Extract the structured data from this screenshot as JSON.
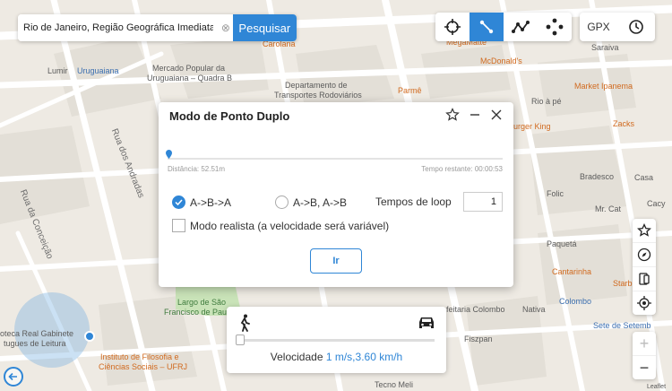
{
  "search": {
    "value": "Rio de Janeiro, Região Geográfica Imediata do",
    "button_label": "Pesquisar"
  },
  "toolbar": {
    "gpx_label": "GPX",
    "accent": "#2f86d6"
  },
  "dialog": {
    "title": "Modo de Ponto Duplo",
    "distance_text": "Distância: 52.51m",
    "remaining_text": "Tempo restante: 00:00:53",
    "option_aba": "A->B->A",
    "option_abab": "A->B, A->B",
    "loop_label": "Tempos de loop",
    "loop_value": "1",
    "realistic_label": "Modo realista (a velocidade será variável)",
    "go_label": "Ir"
  },
  "speed": {
    "label": "Velocidade",
    "value": "1 m/s,3.60 km/h"
  },
  "map_labels": {
    "carolana": "Carolana",
    "megamatte": "MegaMatte",
    "mcdonalds": "McDonald's",
    "saraiva": "Saraiva",
    "lumir": "Lumir",
    "uruguaiana": "Uruguaiana",
    "mercado": "Mercado Popular da",
    "mercado2": "Uruguaiana – Quadra B",
    "departamento": "Departamento de",
    "departamento2": "Transportes Rodoviários",
    "parme": "Parmê",
    "market_ipanema": "Market Ipanema",
    "rio_a_pe": "Rio à pé",
    "zacks": "Zacks",
    "burger_king": "urger King",
    "folic": "Folic",
    "bradesco": "Bradesco",
    "mr_cat": "Mr. Cat",
    "paqueta": "Paquetá",
    "cantarinha": "Cantarinha",
    "colombo": "Colombo",
    "sete_de_setembro": "Sete de Setemb",
    "starb": "Starb",
    "nativa": "Nativa",
    "fiszpan": "Fiszpan",
    "confeitaria_colombo": "feitaria Colombo",
    "largo_sao": "Largo de São",
    "largo_sao2": "Francisco de Paula",
    "instituto": "Instituto de Filosofia e",
    "instituto2": "Ciências Sociais – UFRJ",
    "tecno_meli": "Tecno Meli",
    "real_gabinete": "oteca Real Gabinete",
    "real_gabinete2": "tugues de Leitura",
    "casa": "Casa",
    "cacy": "Cacy",
    "rua_andradas": "Rua dos Andradas",
    "rua_conceicao": "Rua da Conceição",
    "leaflet": "Leaflet"
  }
}
